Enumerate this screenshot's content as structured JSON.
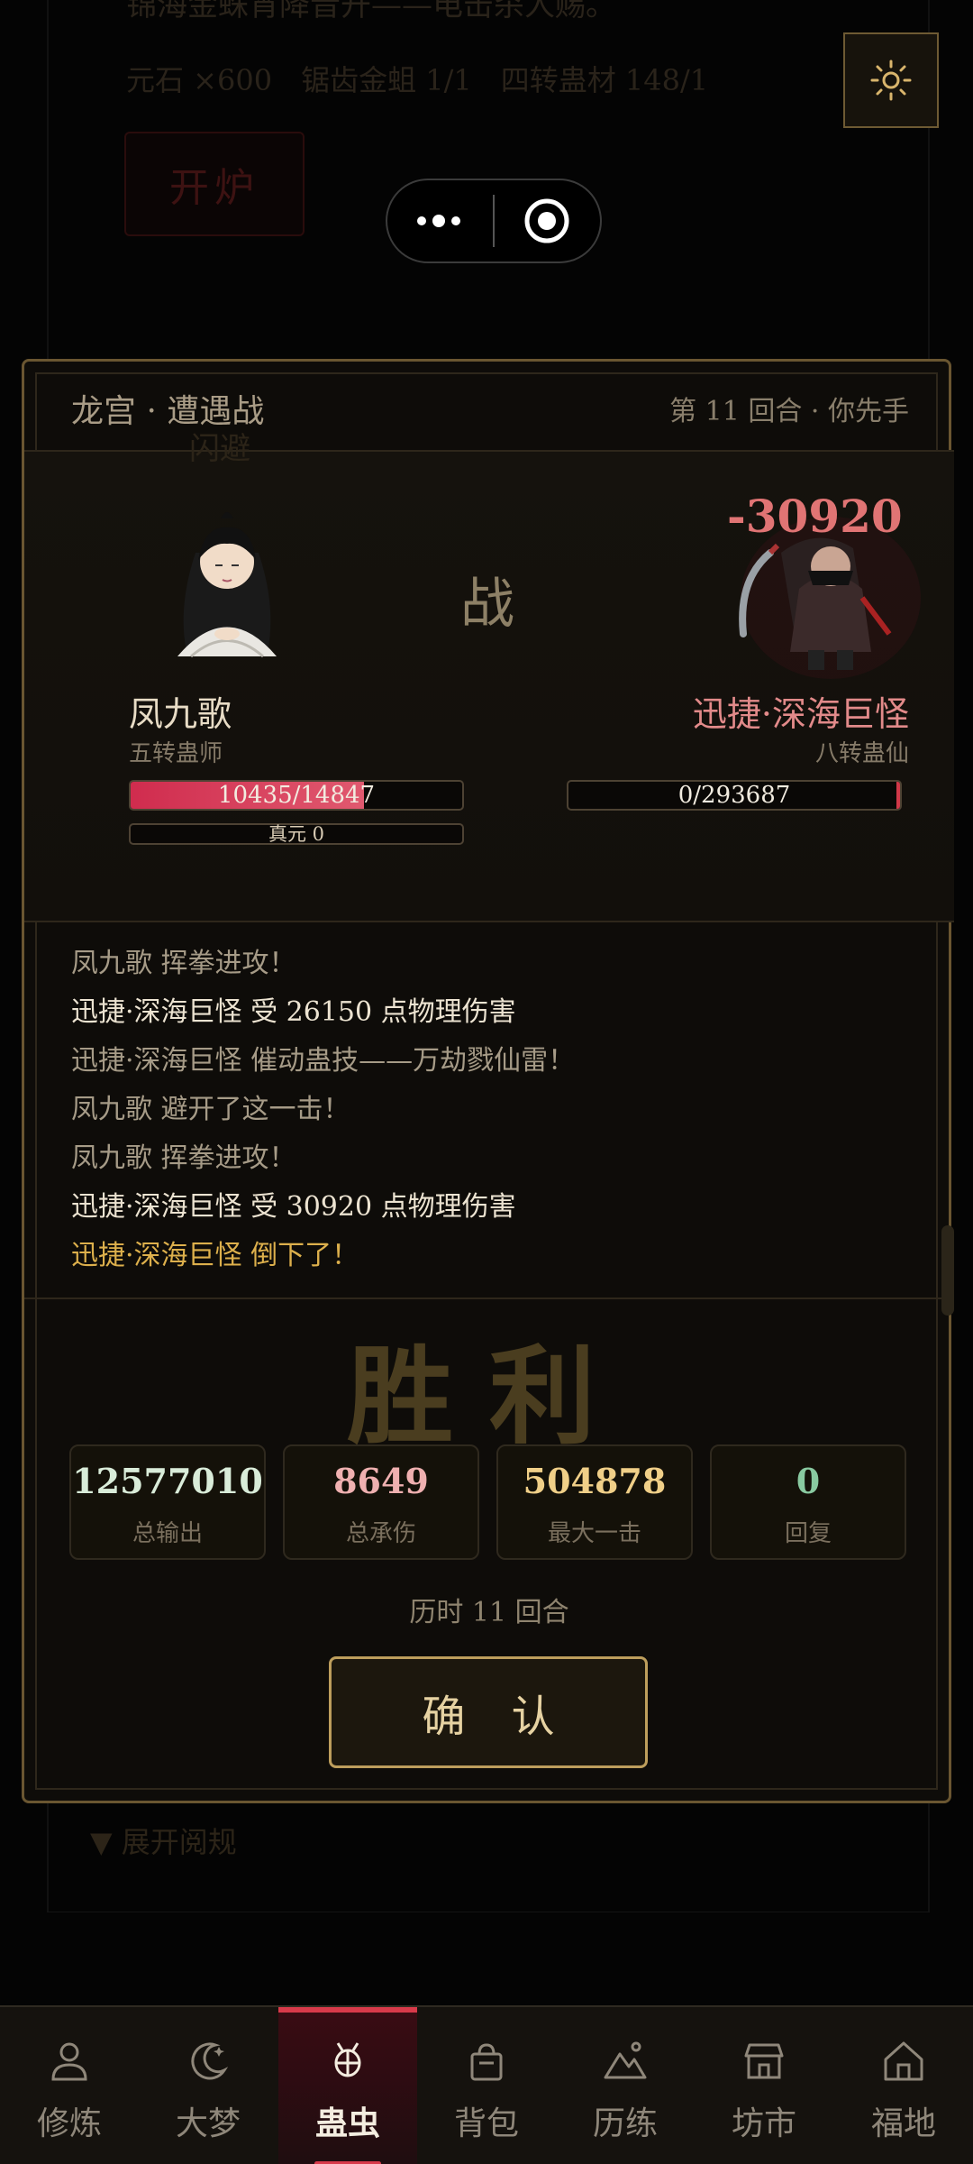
{
  "background": {
    "line1": "锦海金蛛宵降音开——电击杀人赐。",
    "line2": "元石 ×600　锯齿金蛆 1/1　四转蛊材 148/1",
    "start_button": "开炉",
    "dodge_label": "闪避",
    "expand_label": "▼ 展开阅规"
  },
  "battle": {
    "title": "龙宫 · 遭遇战",
    "round_info": "第 11 回合 · 你先手",
    "vs": "战",
    "damage_float": "-30920",
    "player": {
      "name": "凤九歌",
      "rank": "五转蛊师",
      "hp_text": "10435/14847",
      "hp_fraction": 0.703,
      "mp_text": "真元 0"
    },
    "enemy": {
      "name": "迅捷·深海巨怪",
      "rank": "八转蛊仙",
      "hp_text": "0/293687",
      "hp_fraction": 0.0
    },
    "log": [
      {
        "text": "凤九歌 挥拳进攻！",
        "style": "muted"
      },
      {
        "text": "迅捷·深海巨怪 受 26150 点物理伤害",
        "style": "bright"
      },
      {
        "text": "迅捷·深海巨怪 催动蛊技——万劫戮仙雷！",
        "style": "muted"
      },
      {
        "text": "凤九歌 避开了这一击！",
        "style": "muted"
      },
      {
        "text": "凤九歌 挥拳进攻！",
        "style": "muted"
      },
      {
        "text": "迅捷·深海巨怪 受 30920 点物理伤害",
        "style": "bright"
      },
      {
        "text": "迅捷·深海巨怪 倒下了！",
        "style": "gold"
      }
    ]
  },
  "result": {
    "title": "胜利",
    "stats": [
      {
        "value": "12577010",
        "label": "总输出",
        "color": "#d9ecd9"
      },
      {
        "value": "8649",
        "label": "总承伤",
        "color": "#efb0b0"
      },
      {
        "value": "504878",
        "label": "最大一击",
        "color": "#f0cf88"
      },
      {
        "value": "0",
        "label": "回复",
        "color": "#89c9a0"
      }
    ],
    "rounds": "历时 11 回合",
    "confirm": "确 认"
  },
  "tabs": [
    {
      "label": "修炼",
      "icon": "person-icon",
      "active": false
    },
    {
      "label": "大梦",
      "icon": "moon-icon",
      "active": false
    },
    {
      "label": "蛊虫",
      "icon": "bug-icon",
      "active": true
    },
    {
      "label": "背包",
      "icon": "bag-icon",
      "active": false
    },
    {
      "label": "历练",
      "icon": "mountain-icon",
      "active": false
    },
    {
      "label": "坊市",
      "icon": "shop-icon",
      "active": false
    },
    {
      "label": "福地",
      "icon": "home-icon",
      "active": false
    }
  ]
}
